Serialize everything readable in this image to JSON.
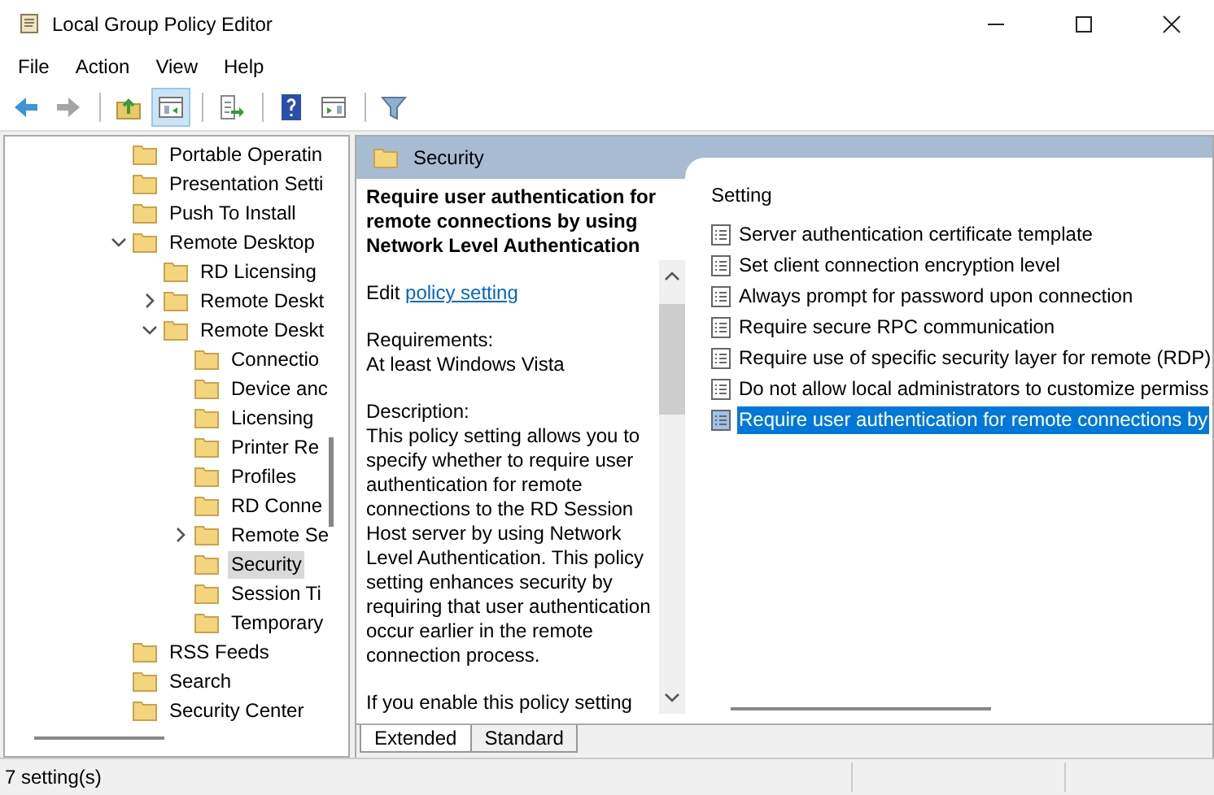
{
  "window": {
    "title": "Local Group Policy Editor"
  },
  "menu": [
    "File",
    "Action",
    "View",
    "Help"
  ],
  "toolbar": [
    {
      "kind": "back",
      "disabled": false,
      "selected": false
    },
    {
      "kind": "forward",
      "disabled": true,
      "selected": false
    },
    {
      "kind": "separator"
    },
    {
      "kind": "up",
      "disabled": false,
      "selected": false
    },
    {
      "kind": "tree",
      "disabled": false,
      "selected": true
    },
    {
      "kind": "separator"
    },
    {
      "kind": "export",
      "disabled": false,
      "selected": false
    },
    {
      "kind": "separator"
    },
    {
      "kind": "help",
      "disabled": false,
      "selected": false
    },
    {
      "kind": "pane",
      "disabled": false,
      "selected": false
    },
    {
      "kind": "separator"
    },
    {
      "kind": "filter",
      "disabled": false,
      "selected": false
    }
  ],
  "tree": [
    {
      "name": "Portable Operatin",
      "selected": false
    },
    {
      "name": "Presentation Setti",
      "selected": false
    },
    {
      "name": "Push To Install",
      "selected": false
    },
    {
      "name": "Remote Desktop",
      "selected": false,
      "expanded": true,
      "children": [
        {
          "name": "RD Licensing",
          "selected": false
        },
        {
          "name": "Remote Deskt",
          "selected": false,
          "expanded": false
        },
        {
          "name": "Remote Deskt",
          "selected": false,
          "expanded": true,
          "children": [
            {
              "name": "Connectio",
              "selected": false
            },
            {
              "name": "Device anc",
              "selected": false
            },
            {
              "name": "Licensing",
              "selected": false
            },
            {
              "name": "Printer Re",
              "selected": false
            },
            {
              "name": "Profiles",
              "selected": false
            },
            {
              "name": "RD Conne",
              "selected": false
            },
            {
              "name": "Remote Se",
              "selected": false,
              "expanded": false
            },
            {
              "name": "Security",
              "selected": true
            },
            {
              "name": "Session Ti",
              "selected": false
            },
            {
              "name": "Temporary",
              "selected": false
            }
          ]
        }
      ]
    },
    {
      "name": "RSS Feeds",
      "selected": false
    },
    {
      "name": "Search",
      "selected": false
    },
    {
      "name": "Security Center",
      "selected": false
    }
  ],
  "details": {
    "header": "Security",
    "title": "Require user authentication for remote connections by using Network Level Authentication",
    "edit_prefix": "Edit",
    "edit_link": "policy setting",
    "requirements_label": "Requirements:",
    "requirements": "At least Windows Vista",
    "description_label": "Description:",
    "description": "This policy setting allows you to specify whether to require user authentication for remote connections to the RD Session Host server by using Network Level Authentication. This policy setting enhances security by requiring that user authentication occur earlier in the remote connection process.",
    "more": "If you enable this policy setting"
  },
  "list": {
    "column": "Setting",
    "rows": [
      {
        "name": "Server authentication certificate template",
        "selected": false
      },
      {
        "name": "Set client connection encryption level",
        "selected": false
      },
      {
        "name": "Always prompt for password upon connection",
        "selected": false
      },
      {
        "name": "Require secure RPC communication",
        "selected": false
      },
      {
        "name": "Require use of specific security layer for remote (RDP)",
        "selected": false
      },
      {
        "name": "Do not allow local administrators to customize permiss",
        "selected": false
      },
      {
        "name": "Require user authentication for remote connections by",
        "selected": true
      }
    ]
  },
  "tabs": [
    {
      "label": "Extended",
      "selected": true
    },
    {
      "label": "Standard",
      "selected": false
    }
  ],
  "status_bar": {
    "text": "7 setting(s)"
  }
}
